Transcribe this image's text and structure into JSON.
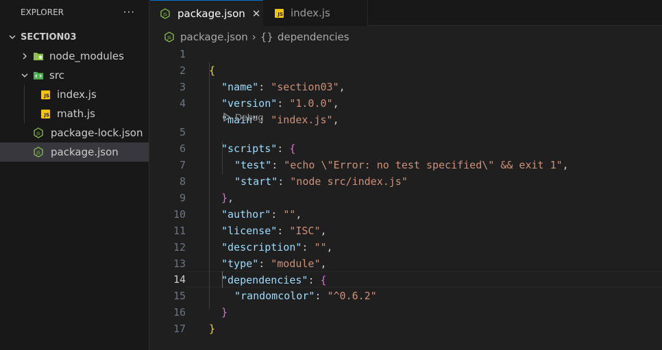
{
  "explorer": {
    "title": "EXPLORER",
    "more_actions": "···",
    "root": "SECTION03",
    "items": [
      {
        "label": "node_modules"
      },
      {
        "label": "src"
      },
      {
        "label": "index.js"
      },
      {
        "label": "math.js"
      },
      {
        "label": "package-lock.json"
      },
      {
        "label": "package.json"
      }
    ]
  },
  "tabs": [
    {
      "label": "package.json",
      "icon": "json-icon"
    },
    {
      "label": "index.js",
      "icon": "js-icon"
    }
  ],
  "tab_close": "✕",
  "breadcrumb": {
    "file": "package.json",
    "separator": "›",
    "symbol_icon": "{}",
    "symbol": "dependencies"
  },
  "codelens": {
    "label": "Debug"
  },
  "editor": {
    "current_line": 14,
    "lines": [
      {
        "n": "1"
      },
      {
        "n": "2"
      },
      {
        "n": "3"
      },
      {
        "n": "4"
      },
      {
        "n": "5"
      },
      {
        "n": "6"
      },
      {
        "n": "7"
      },
      {
        "n": "8"
      },
      {
        "n": "9"
      },
      {
        "n": "10"
      },
      {
        "n": "11"
      },
      {
        "n": "12"
      },
      {
        "n": "13"
      },
      {
        "n": "14"
      },
      {
        "n": "15"
      },
      {
        "n": "16"
      },
      {
        "n": "17"
      }
    ],
    "tokens": {
      "l1_open": "{",
      "l2_key": "\"name\"",
      "l2_val": "\"section03\"",
      "l3_key": "\"version\"",
      "l3_val": "\"1.0.0\"",
      "l4_key": "\"main\"",
      "l4_val": "\"index.js\"",
      "l5_key": "\"scripts\"",
      "l5_open": "{",
      "l6_key": "\"test\"",
      "l6_val": "\"echo \\\"Error: no test specified\\\" && exit 1\"",
      "l7_key": "\"start\"",
      "l7_val": "\"node src/index.js\"",
      "l8_close": "}",
      "l9_key": "\"author\"",
      "l9_val": "\"\"",
      "l10_key": "\"license\"",
      "l10_val": "\"ISC\"",
      "l11_key": "\"description\"",
      "l11_val": "\"\"",
      "l12_key": "\"type\"",
      "l12_val": "\"module\"",
      "l13_key": "\"dependencies\"",
      "l13_open": "{",
      "l14_key": "\"randomcolor\"",
      "l14_val": "\"^0.6.2\"",
      "l15_close": "}",
      "l16_close": "}",
      "colon": ": ",
      "comma": ","
    }
  },
  "colors": {
    "accent": "#0078d4",
    "js_icon": "#f1c40f",
    "json_icon": "#8bc34a",
    "string": "#ce9178",
    "key": "#9cdcfe",
    "bracket_gold": "#ffd700",
    "bracket_magenta": "#da70d6"
  }
}
